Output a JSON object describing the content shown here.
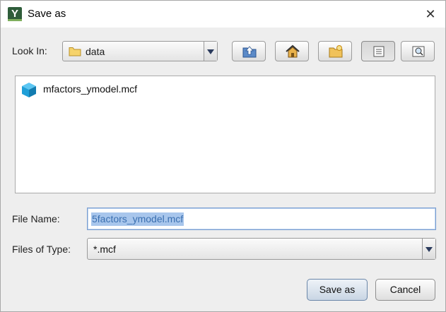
{
  "window": {
    "title": "Save as",
    "app_icon_letter": "Y"
  },
  "look_in": {
    "label": "Look In:",
    "value": "data"
  },
  "toolbar": {
    "icons": [
      "up-one-level-icon",
      "home-icon",
      "new-folder-icon",
      "list-view-icon",
      "details-view-icon"
    ]
  },
  "files": [
    {
      "name": "mfactors_ymodel.mcf",
      "icon": "cube-icon"
    }
  ],
  "file_name": {
    "label": "File Name:",
    "value": "5factors_ymodel.mcf"
  },
  "file_type": {
    "label": "Files of Type:",
    "value": "*.mcf"
  },
  "buttons": {
    "save": "Save as",
    "cancel": "Cancel"
  },
  "colors": {
    "accent": "#1f9fd8",
    "selection": "#a8c6ec",
    "app_icon": "#2f5d3a"
  }
}
